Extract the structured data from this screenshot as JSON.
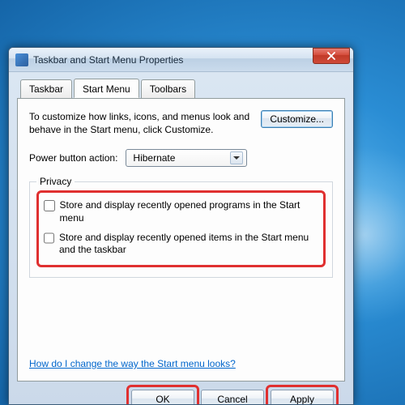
{
  "window": {
    "title": "Taskbar and Start Menu Properties"
  },
  "tabs": [
    {
      "label": "Taskbar",
      "active": false
    },
    {
      "label": "Start Menu",
      "active": true
    },
    {
      "label": "Toolbars",
      "active": false
    }
  ],
  "content": {
    "description": "To customize how links, icons, and menus look and behave in the Start menu, click Customize.",
    "customize_button": "Customize...",
    "power_label": "Power button action:",
    "power_value": "Hibernate",
    "privacy": {
      "legend": "Privacy",
      "option1": "Store and display recently opened programs in the Start menu",
      "option2": "Store and display recently opened items in the Start menu and the taskbar"
    },
    "help_link": "How do I change the way the Start menu looks?"
  },
  "buttons": {
    "ok": "OK",
    "cancel": "Cancel",
    "apply": "Apply"
  }
}
